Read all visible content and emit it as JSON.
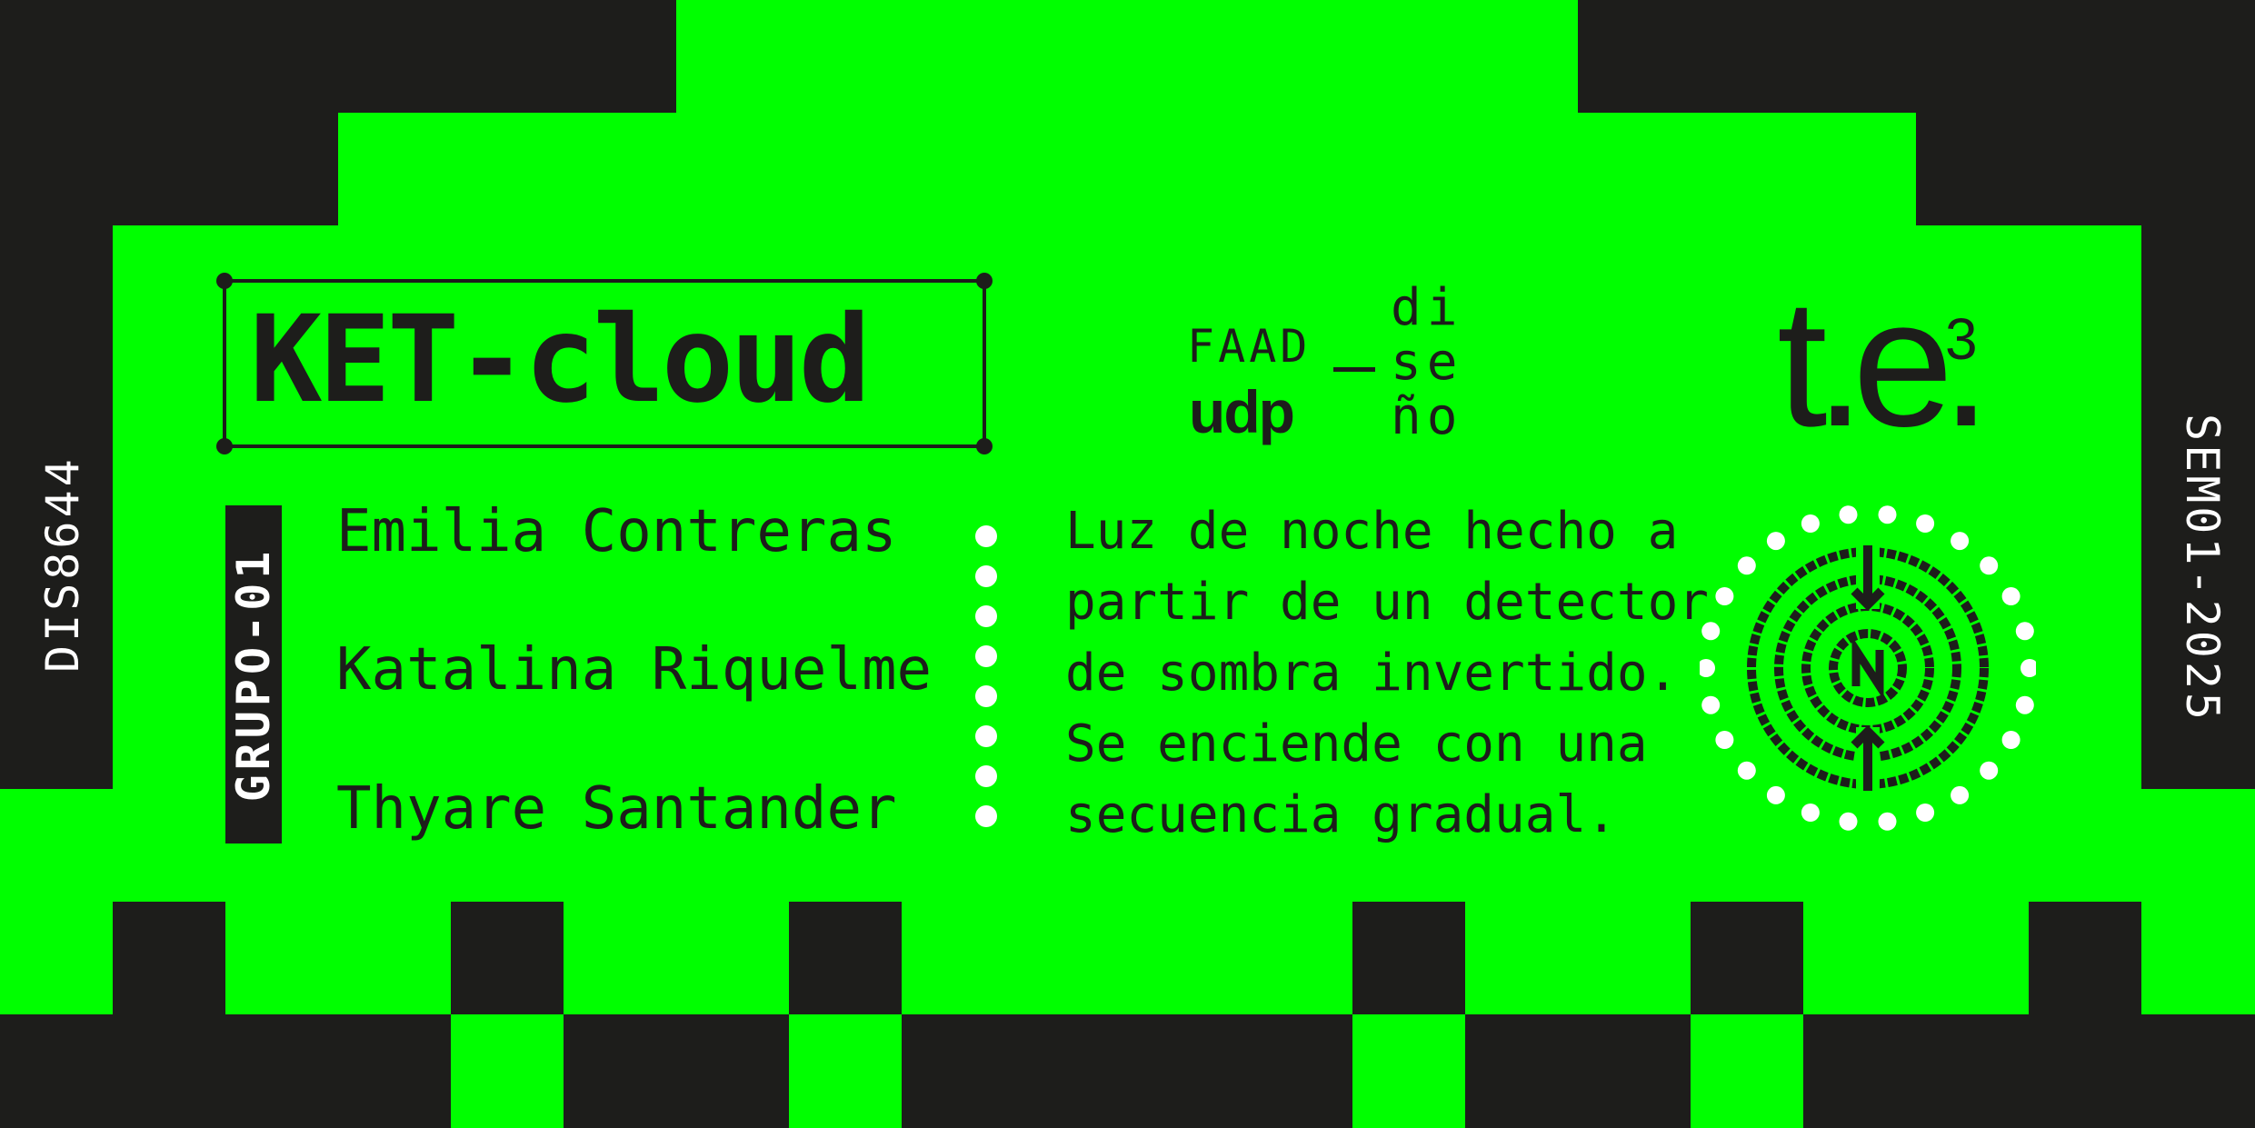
{
  "title": "KET-cloud",
  "group": "GRUPO-01",
  "members": [
    "Emilia Contreras",
    "Katalina Riquelme",
    "Thyare Santander"
  ],
  "description": [
    "Luz de noche hecho a",
    "partir de un detector",
    "de sombra invertido.",
    "Se enciende con una",
    "secuencia gradual."
  ],
  "institution": {
    "faad": "FAAD",
    "udp": "udp",
    "diseno": [
      "di",
      "se",
      "ño"
    ]
  },
  "logo": {
    "main": "t.e.",
    "superscript": "3"
  },
  "side_codes": {
    "left": "DIS8644",
    "right": "SEM01-2025"
  },
  "icons": [
    "space-invader-background",
    "circular-arrows-icon"
  ],
  "colors": {
    "green": "#00ff00",
    "dark": "#1d1d1b",
    "white": "#ffffff"
  }
}
